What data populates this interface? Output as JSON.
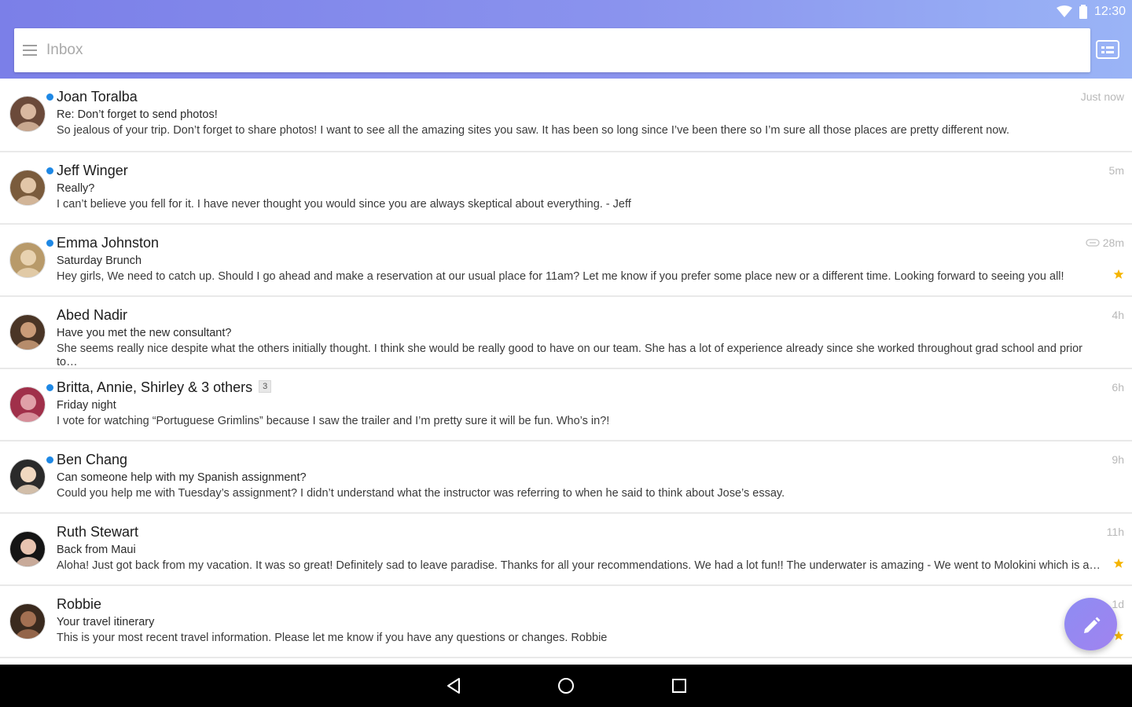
{
  "status_bar": {
    "time": "12:30"
  },
  "search": {
    "placeholder": "Inbox"
  },
  "colors": {
    "accent": "#7b7fe8",
    "unread_dot": "#1e88e5",
    "star": "#f5b400"
  },
  "messages": [
    {
      "sender": "Joan Toralba",
      "subject": "Re: Don’t forget to send photos!",
      "snippet": "So jealous of your trip. Don’t forget to share photos!  I want to see all the amazing sites you saw. It has been so long since I’ve been there so I’m sure all those places are pretty different now.",
      "time": "Just now",
      "unread": true,
      "starred": false,
      "attachment": false,
      "count": ""
    },
    {
      "sender": "Jeff Winger",
      "subject": "Really?",
      "snippet": "I can’t believe you fell for it. I have never thought you would since you are always skeptical about everything. - Jeff",
      "time": "5m",
      "unread": true,
      "starred": false,
      "attachment": false,
      "count": ""
    },
    {
      "sender": "Emma Johnston",
      "subject": "Saturday Brunch",
      "snippet": "Hey girls, We need to catch up. Should I go ahead and make a reservation at our usual place for 11am? Let me know if you prefer some place new or a different time.  Looking forward to seeing you all!",
      "time": "28m",
      "unread": true,
      "starred": true,
      "attachment": true,
      "count": ""
    },
    {
      "sender": "Abed Nadir",
      "subject": "Have you met the new consultant?",
      "snippet": "She seems really nice despite what the others initially thought. I think she would be really good to have on our team. She has a lot of experience already since she worked throughout grad school and prior to…",
      "time": "4h",
      "unread": false,
      "starred": false,
      "attachment": false,
      "count": ""
    },
    {
      "sender": "Britta, Annie, Shirley & 3 others",
      "subject": "Friday night",
      "snippet": "I vote for watching “Portuguese Grimlins” because I saw the trailer and I’m pretty sure it will be fun.  Who’s in?!",
      "time": "6h",
      "unread": true,
      "starred": false,
      "attachment": false,
      "count": "3"
    },
    {
      "sender": "Ben Chang",
      "subject": "Can someone help with my Spanish assignment?",
      "snippet": "Could you help me with Tuesday’s assignment? I didn’t understand what the instructor was referring to when he said to think about Jose’s essay.",
      "time": "9h",
      "unread": true,
      "starred": false,
      "attachment": false,
      "count": ""
    },
    {
      "sender": "Ruth Stewart",
      "subject": "Back from Maui",
      "snippet": "Aloha! Just got back from my vacation. It was so great! Definitely sad to leave paradise. Thanks for all your recommendations. We had a lot fun!!  The underwater is amazing - We went to Molokini which is a…",
      "time": "11h",
      "unread": false,
      "starred": true,
      "attachment": false,
      "count": ""
    },
    {
      "sender": "Robbie",
      "subject": "Your travel itinerary",
      "snippet": "This is your most recent travel information. Please let me know if you have any questions or changes.  Robbie",
      "time": "1d",
      "unread": false,
      "starred": true,
      "attachment": false,
      "count": ""
    }
  ]
}
